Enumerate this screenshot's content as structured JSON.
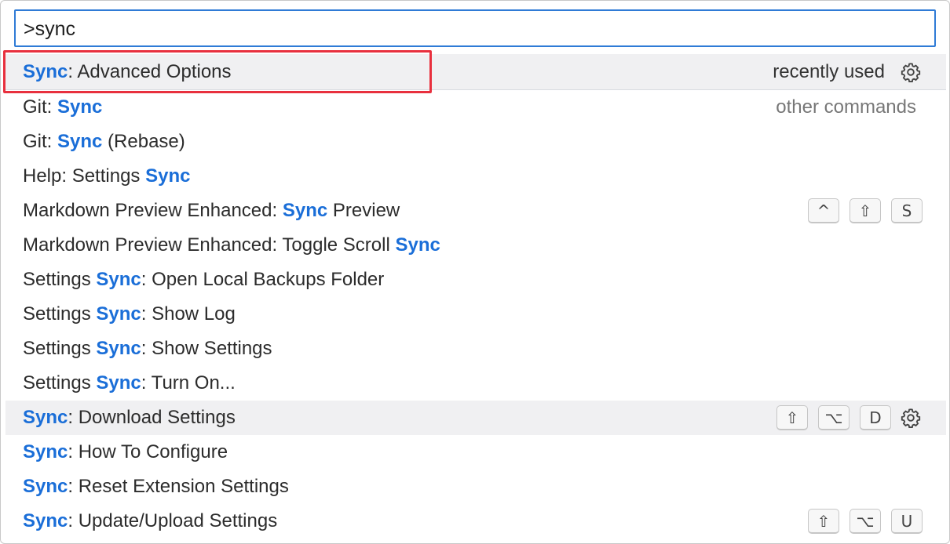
{
  "search": {
    "value": ">sync"
  },
  "items": [
    {
      "parts": [
        {
          "t": "Sync",
          "hl": true
        },
        {
          "t": ": Advanced Options",
          "hl": false
        }
      ],
      "hint": "recently used",
      "hint_muted": false,
      "gear": true,
      "keys": [],
      "shaded": true,
      "first": true
    },
    {
      "parts": [
        {
          "t": "Git: ",
          "hl": false
        },
        {
          "t": "Sync",
          "hl": true
        }
      ],
      "hint": "other commands",
      "hint_muted": true,
      "gear": false,
      "keys": [],
      "shaded": false
    },
    {
      "parts": [
        {
          "t": "Git: ",
          "hl": false
        },
        {
          "t": "Sync",
          "hl": true
        },
        {
          "t": " (Rebase)",
          "hl": false
        }
      ],
      "hint": "",
      "gear": false,
      "keys": [],
      "shaded": false
    },
    {
      "parts": [
        {
          "t": "Help: Settings ",
          "hl": false
        },
        {
          "t": "Sync",
          "hl": true
        }
      ],
      "hint": "",
      "gear": false,
      "keys": [],
      "shaded": false
    },
    {
      "parts": [
        {
          "t": "Markdown Preview Enhanced: ",
          "hl": false
        },
        {
          "t": "Sync",
          "hl": true
        },
        {
          "t": " Preview",
          "hl": false
        }
      ],
      "hint": "",
      "gear": false,
      "keys": [
        "^",
        "⇧",
        "S"
      ],
      "shaded": false
    },
    {
      "parts": [
        {
          "t": "Markdown Preview Enhanced: Toggle Scroll ",
          "hl": false
        },
        {
          "t": "Sync",
          "hl": true
        }
      ],
      "hint": "",
      "gear": false,
      "keys": [],
      "shaded": false
    },
    {
      "parts": [
        {
          "t": "Settings ",
          "hl": false
        },
        {
          "t": "Sync",
          "hl": true
        },
        {
          "t": ": Open Local Backups Folder",
          "hl": false
        }
      ],
      "hint": "",
      "gear": false,
      "keys": [],
      "shaded": false
    },
    {
      "parts": [
        {
          "t": "Settings ",
          "hl": false
        },
        {
          "t": "Sync",
          "hl": true
        },
        {
          "t": ": Show Log",
          "hl": false
        }
      ],
      "hint": "",
      "gear": false,
      "keys": [],
      "shaded": false
    },
    {
      "parts": [
        {
          "t": "Settings ",
          "hl": false
        },
        {
          "t": "Sync",
          "hl": true
        },
        {
          "t": ": Show Settings",
          "hl": false
        }
      ],
      "hint": "",
      "gear": false,
      "keys": [],
      "shaded": false
    },
    {
      "parts": [
        {
          "t": "Settings ",
          "hl": false
        },
        {
          "t": "Sync",
          "hl": true
        },
        {
          "t": ": Turn On...",
          "hl": false
        }
      ],
      "hint": "",
      "gear": false,
      "keys": [],
      "shaded": false
    },
    {
      "parts": [
        {
          "t": "Sync",
          "hl": true
        },
        {
          "t": ": Download Settings",
          "hl": false
        }
      ],
      "hint": "",
      "gear": true,
      "keys": [
        "⇧",
        "⌥",
        "D"
      ],
      "shaded": true
    },
    {
      "parts": [
        {
          "t": "Sync",
          "hl": true
        },
        {
          "t": ": How To Configure",
          "hl": false
        }
      ],
      "hint": "",
      "gear": false,
      "keys": [],
      "shaded": false
    },
    {
      "parts": [
        {
          "t": "Sync",
          "hl": true
        },
        {
          "t": ": Reset Extension Settings",
          "hl": false
        }
      ],
      "hint": "",
      "gear": false,
      "keys": [],
      "shaded": false
    },
    {
      "parts": [
        {
          "t": "Sync",
          "hl": true
        },
        {
          "t": ": Update/Upload Settings",
          "hl": false
        }
      ],
      "hint": "",
      "gear": false,
      "keys": [
        "⇧",
        "⌥",
        "U"
      ],
      "shaded": false
    }
  ],
  "colors": {
    "accent": "#1a6ed8",
    "focus_border": "#2f7bd6",
    "annotation": "#e8303e"
  },
  "icons": {
    "gear": "gear-icon"
  }
}
